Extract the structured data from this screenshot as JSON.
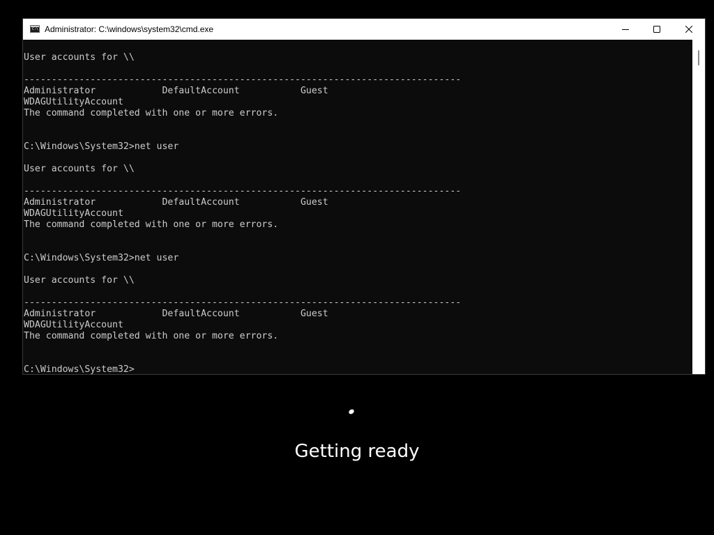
{
  "window": {
    "title": "Administrator: C:\\windows\\system32\\cmd.exe",
    "app_icon": "cmd-icon",
    "app_icon_text": "C:\\",
    "controls": {
      "minimize_icon": "minimize-icon",
      "maximize_icon": "maximize-icon",
      "close_icon": "close-icon"
    }
  },
  "console": {
    "text_color": "#cccccc",
    "background": "#0c0c0c",
    "lines": [
      "User accounts for \\\\",
      "",
      "-------------------------------------------------------------------------------",
      "Administrator            DefaultAccount           Guest",
      "WDAGUtilityAccount",
      "The command completed with one or more errors.",
      "",
      "",
      "C:\\Windows\\System32>net user",
      "",
      "User accounts for \\\\",
      "",
      "-------------------------------------------------------------------------------",
      "Administrator            DefaultAccount           Guest",
      "WDAGUtilityAccount",
      "The command completed with one or more errors.",
      "",
      "",
      "C:\\Windows\\System32>net user",
      "",
      "User accounts for \\\\",
      "",
      "-------------------------------------------------------------------------------",
      "Administrator            DefaultAccount           Guest",
      "WDAGUtilityAccount",
      "The command completed with one or more errors.",
      "",
      "",
      "C:\\Windows\\System32>"
    ]
  },
  "setup": {
    "status": "Getting ready",
    "spinner_icon": "loading-spinner-icon"
  }
}
